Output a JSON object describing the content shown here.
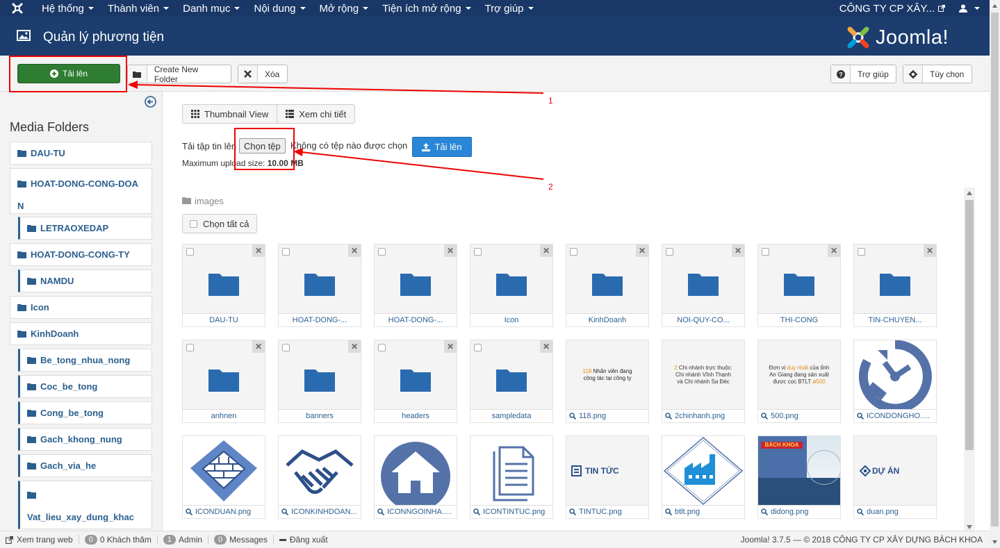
{
  "nav": {
    "menus": [
      "Hệ thống",
      "Thành viên",
      "Danh mục",
      "Nội dung",
      "Mở rộng",
      "Tiện ích mở rộng",
      "Trợ giúp"
    ],
    "site_link": "CÔNG TY CP XÂY..."
  },
  "header": {
    "title": "Quản lý phương tiện",
    "brand": "Joomla!"
  },
  "toolbar": {
    "upload": "Tải lên",
    "create_folder": "Create New Folder",
    "delete": "Xóa",
    "help": "Trợ giúp",
    "options": "Tùy chọn"
  },
  "sidebar": {
    "heading": "Media Folders",
    "folders": [
      {
        "label": "DAU-TU"
      },
      {
        "label": "HOAT-DONG-CONG-DOAN"
      },
      {
        "label": "LETRAOXEDAP"
      },
      {
        "label": "HOAT-DONG-CONG-TY"
      },
      {
        "label": "NAMDU"
      },
      {
        "label": "Icon"
      },
      {
        "label": "KinhDoanh"
      },
      {
        "label": "Be_tong_nhua_nong"
      },
      {
        "label": "Coc_be_tong"
      },
      {
        "label": "Cong_be_tong"
      },
      {
        "label": "Gach_khong_nung"
      },
      {
        "label": "Gach_via_he"
      },
      {
        "label": "Vat_lieu_xay_dung_khac"
      }
    ]
  },
  "view": {
    "thumbnail": "Thumbnail View",
    "detail": "Xem chi tiết"
  },
  "upload": {
    "label": "Tải tập tin lên",
    "choose": "Chọn tệp",
    "no_file": "Không có tệp nào được chọn",
    "button": "Tải lên",
    "max_label": "Maximum upload size: ",
    "max_value": "10.00 MB"
  },
  "breadcrumb": "images",
  "select_all": "Chọn tất cả",
  "items": [
    {
      "name": "DAU-TU",
      "kind": "folder"
    },
    {
      "name": "HOAT-DONG-...",
      "kind": "folder"
    },
    {
      "name": "HOAT-DONG-...",
      "kind": "folder"
    },
    {
      "name": "Icon",
      "kind": "folder"
    },
    {
      "name": "KinhDoanh",
      "kind": "folder"
    },
    {
      "name": "NOI-QUY-CO...",
      "kind": "folder"
    },
    {
      "name": "THI-CONG",
      "kind": "folder"
    },
    {
      "name": "TIN-CHUYEN...",
      "kind": "folder"
    },
    {
      "name": "anhnen",
      "kind": "folder"
    },
    {
      "name": "banners",
      "kind": "folder"
    },
    {
      "name": "headers",
      "kind": "folder"
    },
    {
      "name": "sampledata",
      "kind": "folder"
    },
    {
      "name": "118.png",
      "kind": "image",
      "preview": "118 Nhân viên đang công tác tại công ty"
    },
    {
      "name": "2chinhanh.png",
      "kind": "image",
      "preview": "2 Chi nhánh trực thuộc: Chi nhánh Vĩnh Thạnh và Chi nhánh Sa Đéc"
    },
    {
      "name": "500.png",
      "kind": "image",
      "preview": "Đơn vị duy nhất của tỉnh An Giang đang sản xuất được cọc BTLT ø500"
    },
    {
      "name": "ICONDONGHO.png",
      "kind": "image",
      "preview": "clock-icon"
    },
    {
      "name": "ICONDUAN.png",
      "kind": "image",
      "preview": "wall-icon"
    },
    {
      "name": "ICONKINHDOAN...",
      "kind": "image",
      "preview": "handshake-icon"
    },
    {
      "name": "ICONNGOINHA.png",
      "kind": "image",
      "preview": "house-icon"
    },
    {
      "name": "ICONTINTUC.png",
      "kind": "image",
      "preview": "documents-icon"
    },
    {
      "name": "TINTUC.png",
      "kind": "image",
      "preview": "TIN TỨC"
    },
    {
      "name": "btlt.png",
      "kind": "image",
      "preview": "factory-icon"
    },
    {
      "name": "didong.png",
      "kind": "image",
      "preview": "BÁCH KHOA"
    },
    {
      "name": "duan.png",
      "kind": "image",
      "preview": "DỰ ÁN"
    }
  ],
  "footer": {
    "view_site": "Xem trang web",
    "visitors_count": "0",
    "visitors_label": "0 Khách thăm",
    "admin_count": "1",
    "admin_label": "Admin",
    "messages_count": "0",
    "messages_label": "Messages",
    "logout": "Đăng xuất",
    "version": "Joomla! 3.7.5 — © 2018 CÔNG TY CP XÂY DỰNG BÁCH KHOA"
  },
  "annotations": [
    "1",
    "2"
  ],
  "colors": {
    "nav": "#1a3867",
    "header": "#1c3d6e",
    "link": "#2b5f8e",
    "green": "#2f7d32",
    "blue": "#2a86d6",
    "annotation": "#e00000"
  }
}
